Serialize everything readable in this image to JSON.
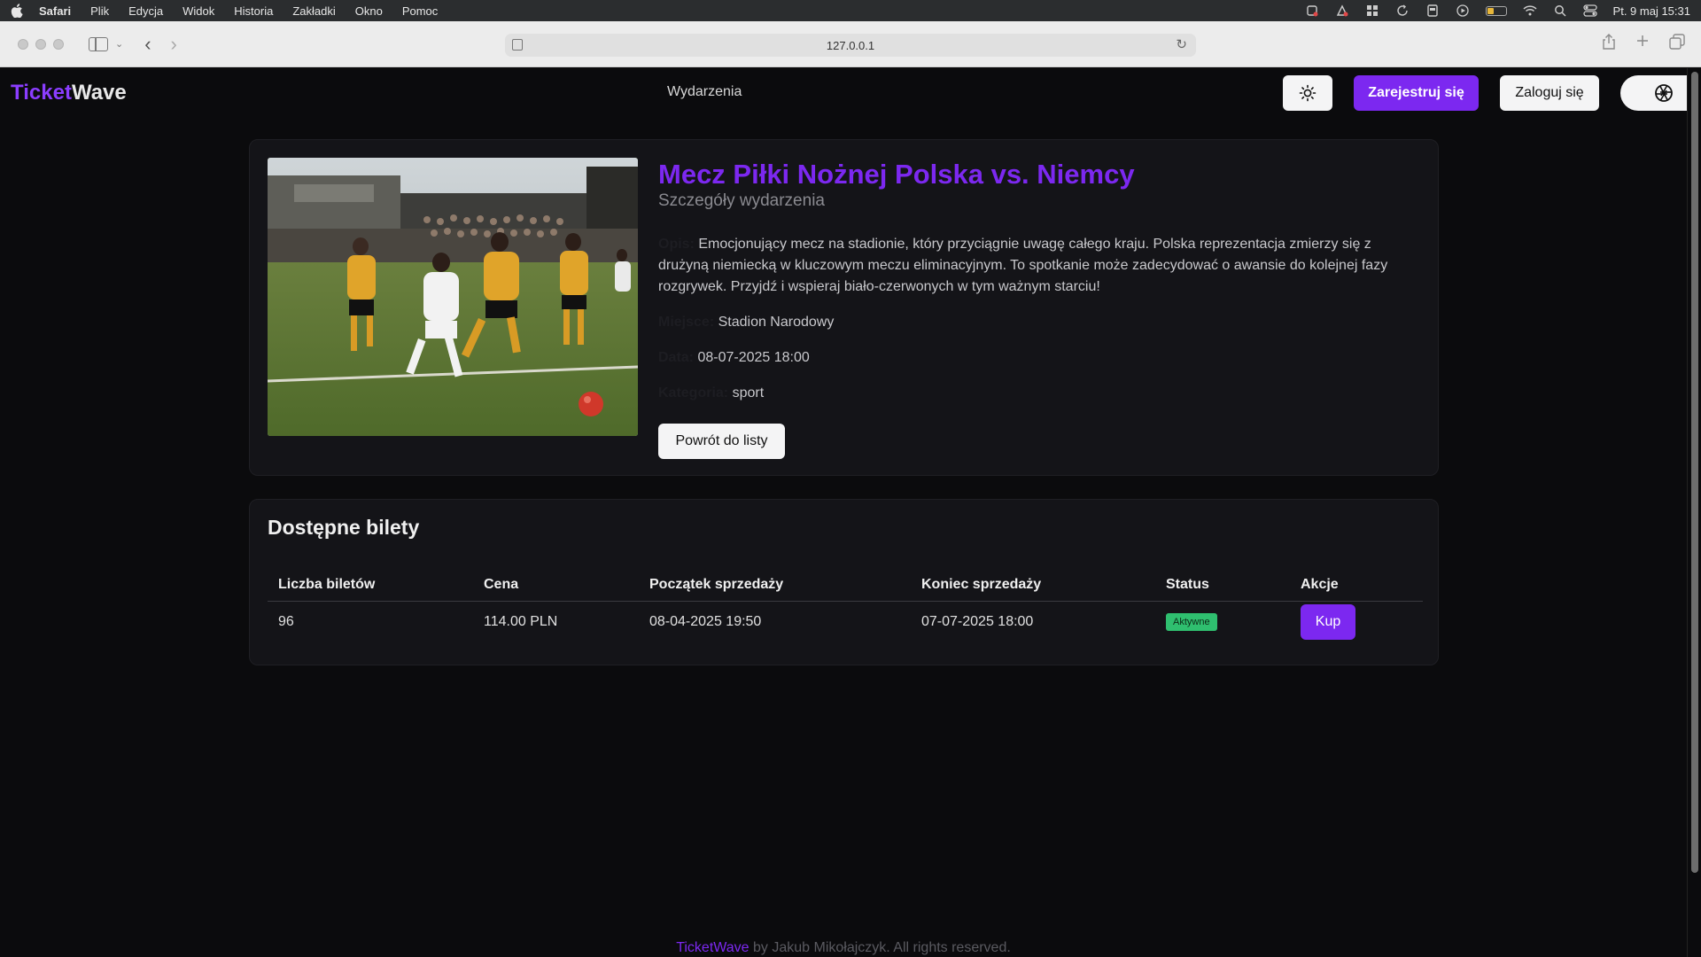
{
  "menubar": {
    "items": [
      "Safari",
      "Plik",
      "Edycja",
      "Widok",
      "Historia",
      "Zakładki",
      "Okno",
      "Pomoc"
    ],
    "clock": "Pt. 9 maj  15:31"
  },
  "browser": {
    "url": "127.0.0.1"
  },
  "app": {
    "logo_part1": "Ticket",
    "logo_part2": "Wave",
    "nav_link": "Wydarzenia",
    "register_label": "Zarejestruj się",
    "login_label": "Zaloguj się",
    "accent_color": "#7c28f0"
  },
  "event": {
    "title": "Mecz Piłki Nożnej Polska vs. Niemcy",
    "subtitle": "Szczegóły wydarzenia",
    "description_label": "Opis:",
    "description": "Emocjonujący mecz na stadionie, który przyciągnie uwagę całego kraju. Polska reprezentacja zmierzy się z drużyną niemiecką w kluczowym meczu eliminacyjnym. To spotkanie może zadecydować o awansie do kolejnej fazy rozgrywek. Przyjdź i wspieraj biało-czerwonych w tym ważnym starciu!",
    "place_label": "Miejsce:",
    "place": "Stadion Narodowy",
    "date_label": "Data:",
    "date": "08-07-2025 18:00",
    "category_label": "Kategoria:",
    "category": "sport",
    "back_label": "Powrót do listy"
  },
  "tickets": {
    "title": "Dostępne bilety",
    "columns": [
      "Liczba biletów",
      "Cena",
      "Początek sprzedaży",
      "Koniec sprzedaży",
      "Status",
      "Akcje"
    ],
    "rows": [
      {
        "count": "96",
        "price": "114.00 PLN",
        "sale_start": "08-04-2025 19:50",
        "sale_end": "07-07-2025 18:00",
        "status": "Aktywne",
        "action": "Kup"
      }
    ]
  },
  "footer": {
    "brand": "TicketWave",
    "text": " by Jakub Mikołajczyk. All rights reserved."
  }
}
